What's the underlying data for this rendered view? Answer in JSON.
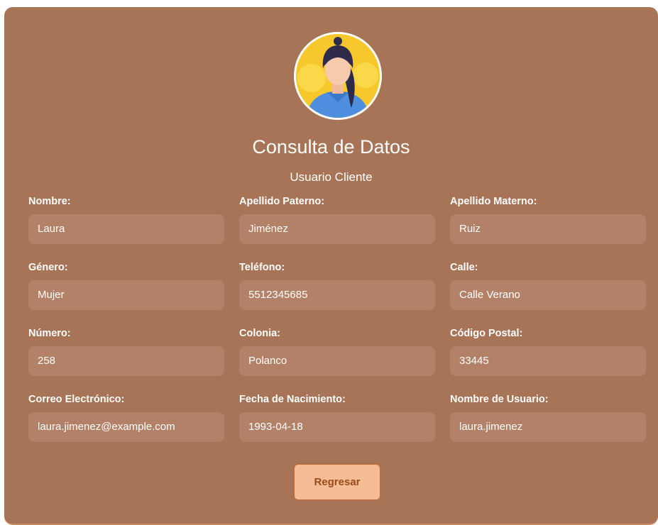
{
  "header": {
    "title": "Consulta de Datos",
    "subtitle": "Usuario Cliente"
  },
  "avatar": {
    "icon": "woman-avatar-icon"
  },
  "fields": [
    {
      "label": "Nombre:",
      "value": "Laura"
    },
    {
      "label": "Apellido Paterno:",
      "value": "Jiménez"
    },
    {
      "label": "Apellido Materno:",
      "value": "Ruiz"
    },
    {
      "label": "Género:",
      "value": "Mujer"
    },
    {
      "label": "Teléfono:",
      "value": "5512345685"
    },
    {
      "label": "Calle:",
      "value": "Calle Verano"
    },
    {
      "label": "Número:",
      "value": "258"
    },
    {
      "label": "Colonia:",
      "value": "Polanco"
    },
    {
      "label": "Código Postal:",
      "value": "33445"
    },
    {
      "label": "Correo Electrónico:",
      "value": "laura.jimenez@example.com"
    },
    {
      "label": "Fecha de Nacimiento:",
      "value": "1993-04-18"
    },
    {
      "label": "Nombre de Usuario:",
      "value": "laura.jimenez"
    }
  ],
  "actions": {
    "back_label": "Regresar"
  },
  "colors": {
    "card_background": "#a87458",
    "field_background": "#b38168",
    "button_background": "#f5bc96",
    "button_text": "#9a4a1c",
    "avatar_background": "#f7c72c"
  }
}
